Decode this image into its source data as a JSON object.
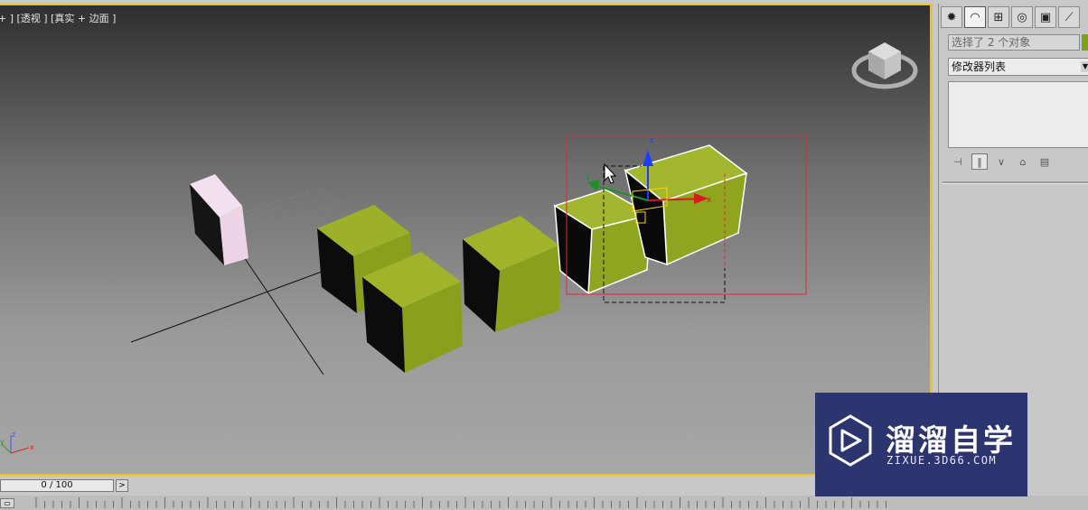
{
  "viewport": {
    "label": "+ ] [透视 ] [真实 + 边面 ]",
    "axes": {
      "x": "x",
      "y": "y",
      "z": "z"
    },
    "gizmo": {
      "z": "z",
      "x": "x",
      "y": "y"
    },
    "colors": {
      "active_border": "#f0c21a",
      "box_color": "#8ea51b",
      "pink_box": "#efd3e6",
      "selection_box": "#e0283a"
    }
  },
  "command_panel": {
    "tabs": [
      "create-icon",
      "modify-icon",
      "hierarchy-icon",
      "motion-icon",
      "display-icon",
      "utilities-icon"
    ],
    "selection_text": "选择了 2 个对象",
    "modifier_list": "修改器列表",
    "stack_tools": [
      "pin-stack-icon",
      "show-end-result-icon",
      "make-unique-icon",
      "remove-modifier-icon",
      "configure-sets-icon"
    ]
  },
  "timeline": {
    "frame_label": "0 / 100",
    "next_label": ">"
  },
  "watermark": {
    "title": "溜溜自学",
    "url": "ZIXUE.3D66.COM"
  }
}
